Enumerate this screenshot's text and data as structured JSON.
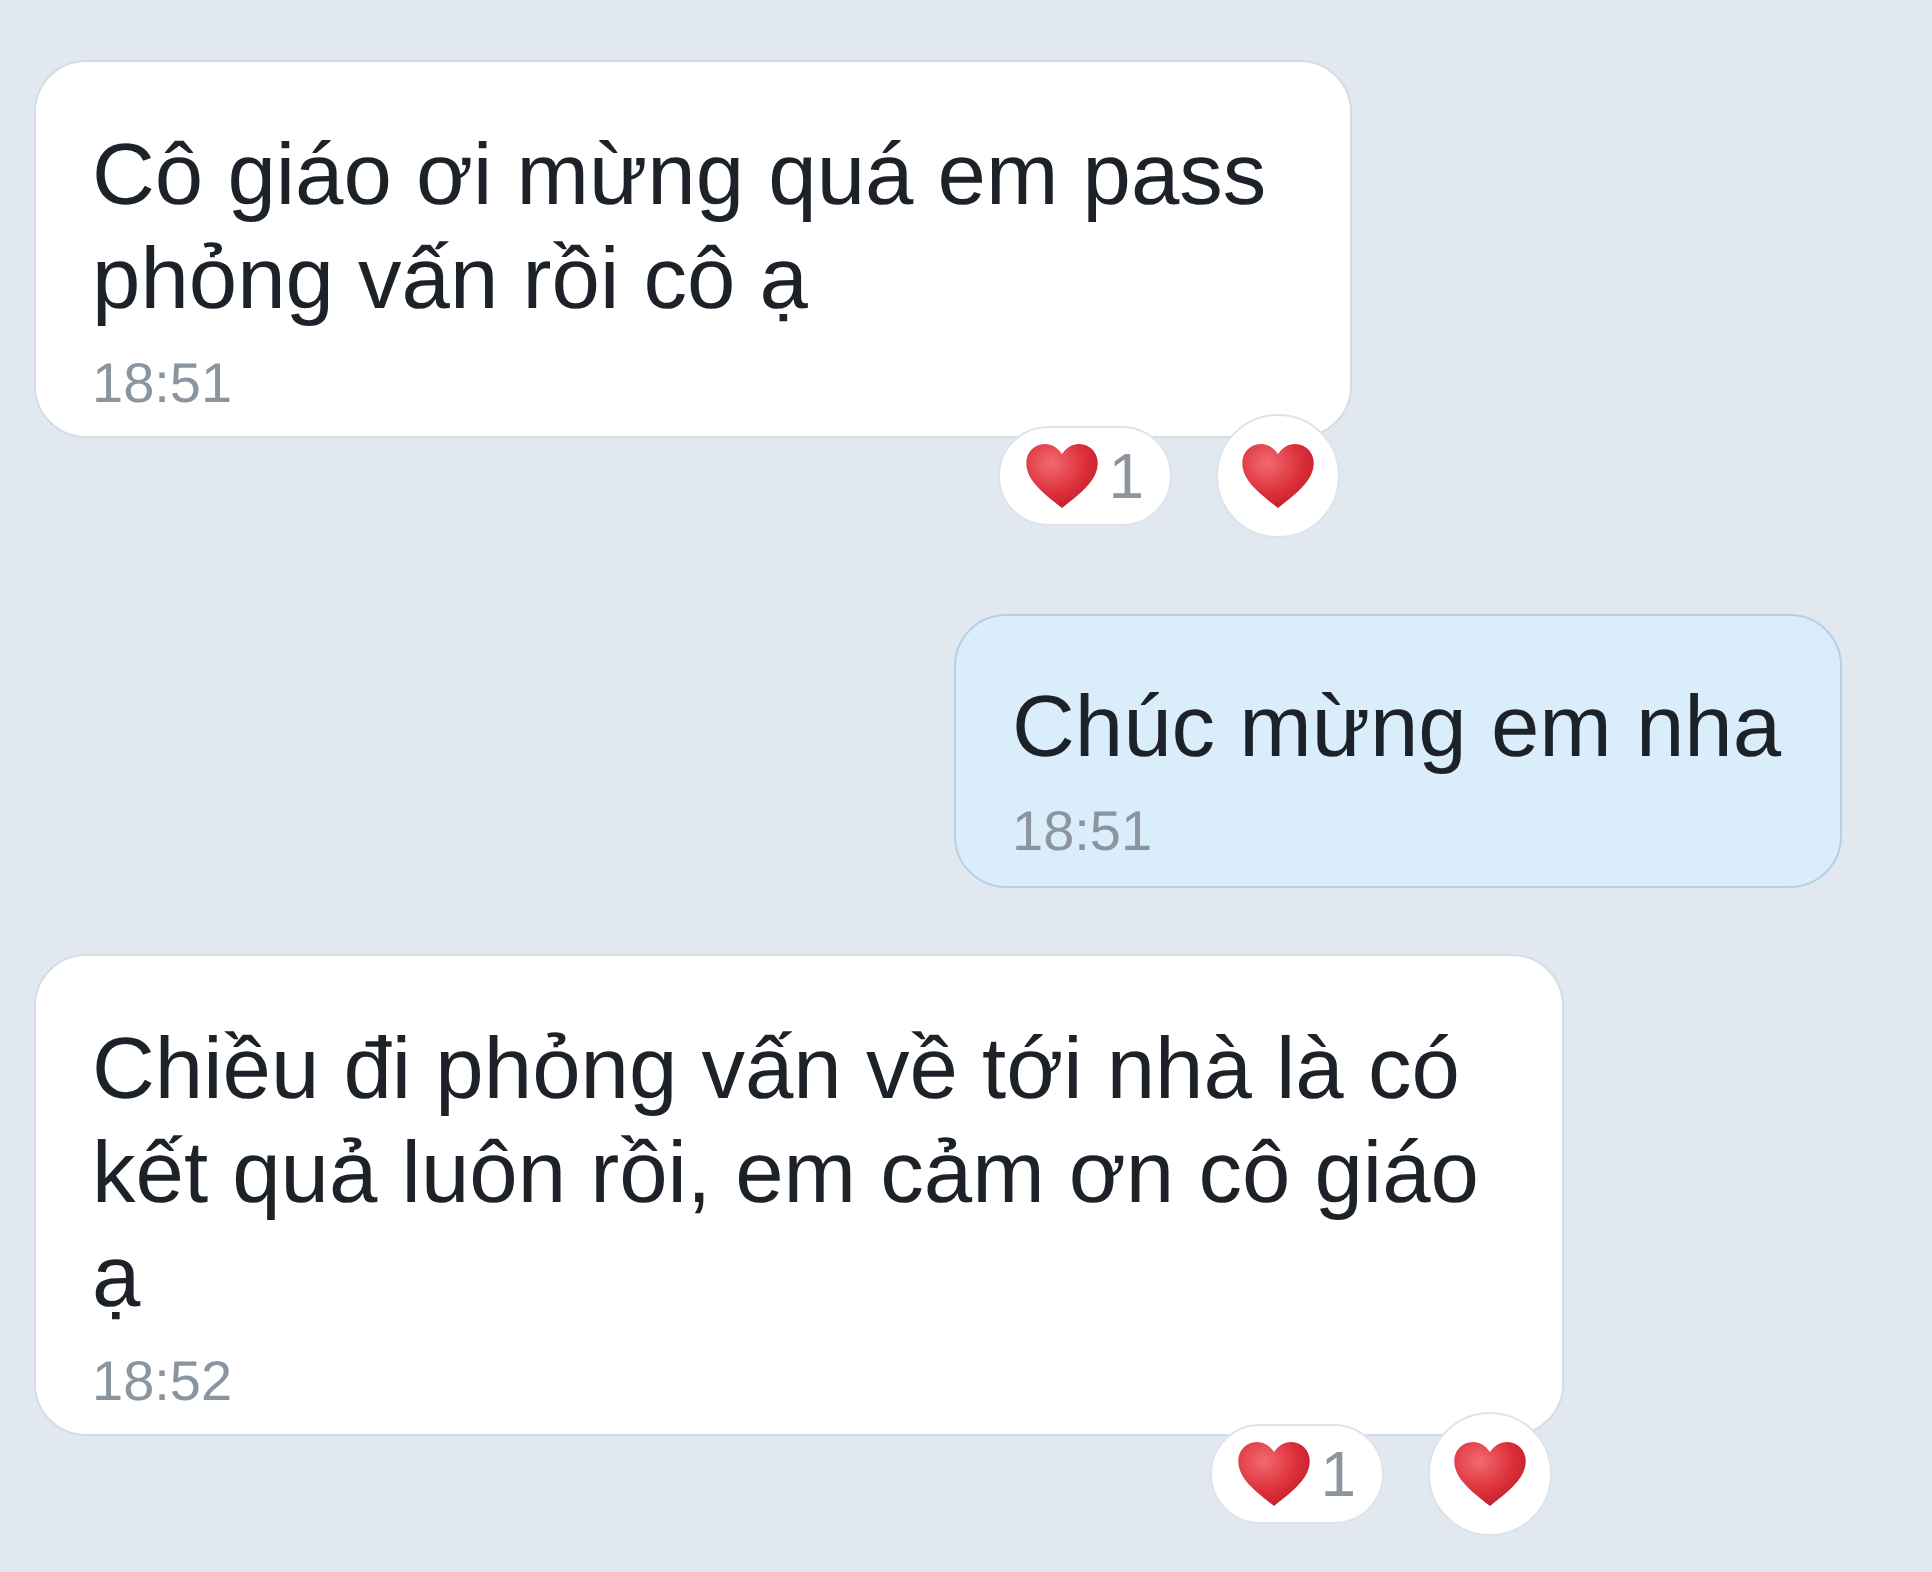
{
  "messages": [
    {
      "outgoing": false,
      "text": "Cô giáo ơi mừng quá em pass phỏng vấn rồi cô ạ",
      "time": "18:51",
      "reactions": [
        {
          "kind": "count",
          "count": "1"
        },
        {
          "kind": "add"
        }
      ]
    },
    {
      "outgoing": true,
      "text": "Chúc mừng em nha",
      "time": "18:51"
    },
    {
      "outgoing": false,
      "text": "Chiều đi phỏng vấn về tới nhà là có kết quả luôn rồi, em cảm ơn cô giáo ạ",
      "time": "18:52",
      "reactions": [
        {
          "kind": "count",
          "count": "1"
        },
        {
          "kind": "add"
        }
      ]
    }
  ]
}
